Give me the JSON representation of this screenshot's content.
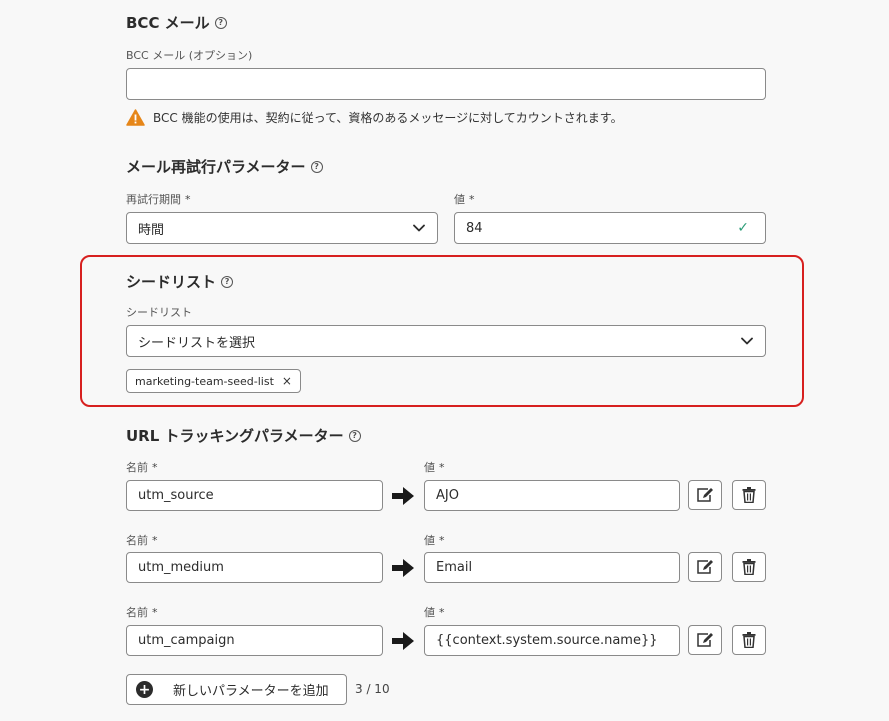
{
  "bcc": {
    "heading": "BCC メール",
    "label": "BCC メール (オプション)",
    "value": "",
    "warning": "BCC 機能の使用は、契約に従って、資格のあるメッセージに対してカウントされます。"
  },
  "retry": {
    "heading": "メール再試行パラメーター",
    "period_label": "再試行期間",
    "period_value": "時間",
    "value_label": "値",
    "value": "84",
    "required_mark": "*"
  },
  "seed": {
    "heading": "シードリスト",
    "label": "シードリスト",
    "placeholder": "シードリストを選択",
    "tag": "marketing-team-seed-list",
    "tag_remove": "×"
  },
  "url_tracking": {
    "heading": "URL トラッキングパラメーター",
    "name_label": "名前",
    "value_label": "値",
    "required_mark": "*",
    "rows": [
      {
        "name": "utm_source",
        "value": "AJO"
      },
      {
        "name": "utm_medium",
        "value": "Email"
      },
      {
        "name": "utm_campaign",
        "value": "{{context.system.source.name}}"
      }
    ],
    "add_button": "新しいパラメーターを追加",
    "count": "3 / 10"
  },
  "icons": [
    "help-icon",
    "warning-icon",
    "chevron-down-icon",
    "checkmark-icon",
    "arrow-right-icon",
    "edit-icon",
    "delete-icon",
    "add-icon",
    "close-icon"
  ],
  "colors": {
    "highlight": "#d7201f",
    "warning": "#e68619",
    "valid": "#2d9d78"
  }
}
